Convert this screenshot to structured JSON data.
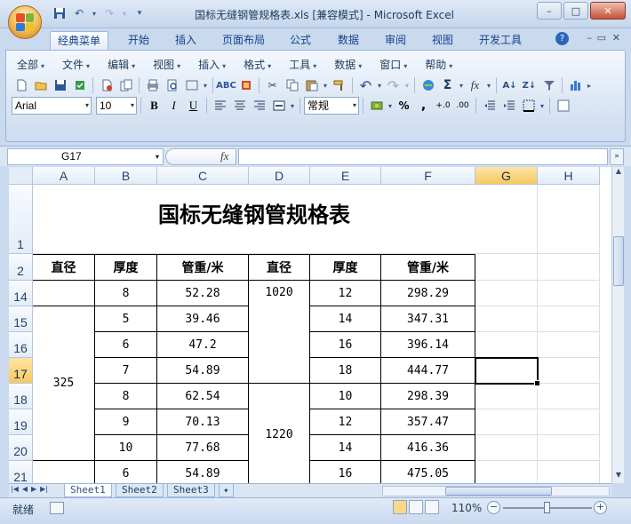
{
  "window": {
    "title": "国标无缝钢管规格表.xls  [兼容模式] - Microsoft Excel",
    "minimize": "–",
    "maximize": "□",
    "close": "✕"
  },
  "qat": {
    "undo": "↶",
    "redo": "↷",
    "more": "▾"
  },
  "tabs": {
    "items": [
      "经典菜单",
      "开始",
      "插入",
      "页面布局",
      "公式",
      "数据",
      "审阅",
      "视图",
      "开发工具"
    ],
    "help": "?"
  },
  "menus": [
    "全部",
    "文件",
    "编辑",
    "视图",
    "插入",
    "格式",
    "工具",
    "数据",
    "窗口",
    "帮助"
  ],
  "format": {
    "font_name": "Arial",
    "font_size": "10",
    "bold": "B",
    "italic": "I",
    "underline": "U",
    "number_format": "常规",
    "percent": "%",
    "comma": ",",
    "inc_decimal": "+.0",
    "dec_decimal": ".00"
  },
  "formula_bar": {
    "name_box": "G17",
    "fx": "fx",
    "value": ""
  },
  "columns": [
    "A",
    "B",
    "C",
    "D",
    "E",
    "F",
    "G",
    "H"
  ],
  "rows": [
    "1",
    "2",
    "14",
    "15",
    "16",
    "17",
    "18",
    "19",
    "20",
    "21"
  ],
  "sheet": {
    "title": "国标无缝钢管规格表",
    "headers": [
      "直径",
      "厚度",
      "管重/米",
      "直径",
      "厚度",
      "管重/米"
    ],
    "left_diameter": "325",
    "right_diameter_1": "1020",
    "right_diameter_2": "1220",
    "data": [
      [
        "",
        "8",
        "52.28",
        "",
        "12",
        "298.29"
      ],
      [
        "",
        "5",
        "39.46",
        "",
        "14",
        "347.31"
      ],
      [
        "",
        "6",
        "47.2",
        "",
        "16",
        "396.14"
      ],
      [
        "",
        "7",
        "54.89",
        "",
        "18",
        "444.77"
      ],
      [
        "",
        "8",
        "62.54",
        "",
        "10",
        "298.39"
      ],
      [
        "",
        "9",
        "70.13",
        "",
        "12",
        "357.47"
      ],
      [
        "",
        "10",
        "77.68",
        "",
        "14",
        "416.36"
      ],
      [
        "",
        "6",
        "54.89",
        "",
        "16",
        "475.05"
      ]
    ]
  },
  "sheet_tabs": [
    "Sheet1",
    "Sheet2",
    "Sheet3"
  ],
  "status": {
    "ready": "就绪",
    "zoom": "110%"
  }
}
